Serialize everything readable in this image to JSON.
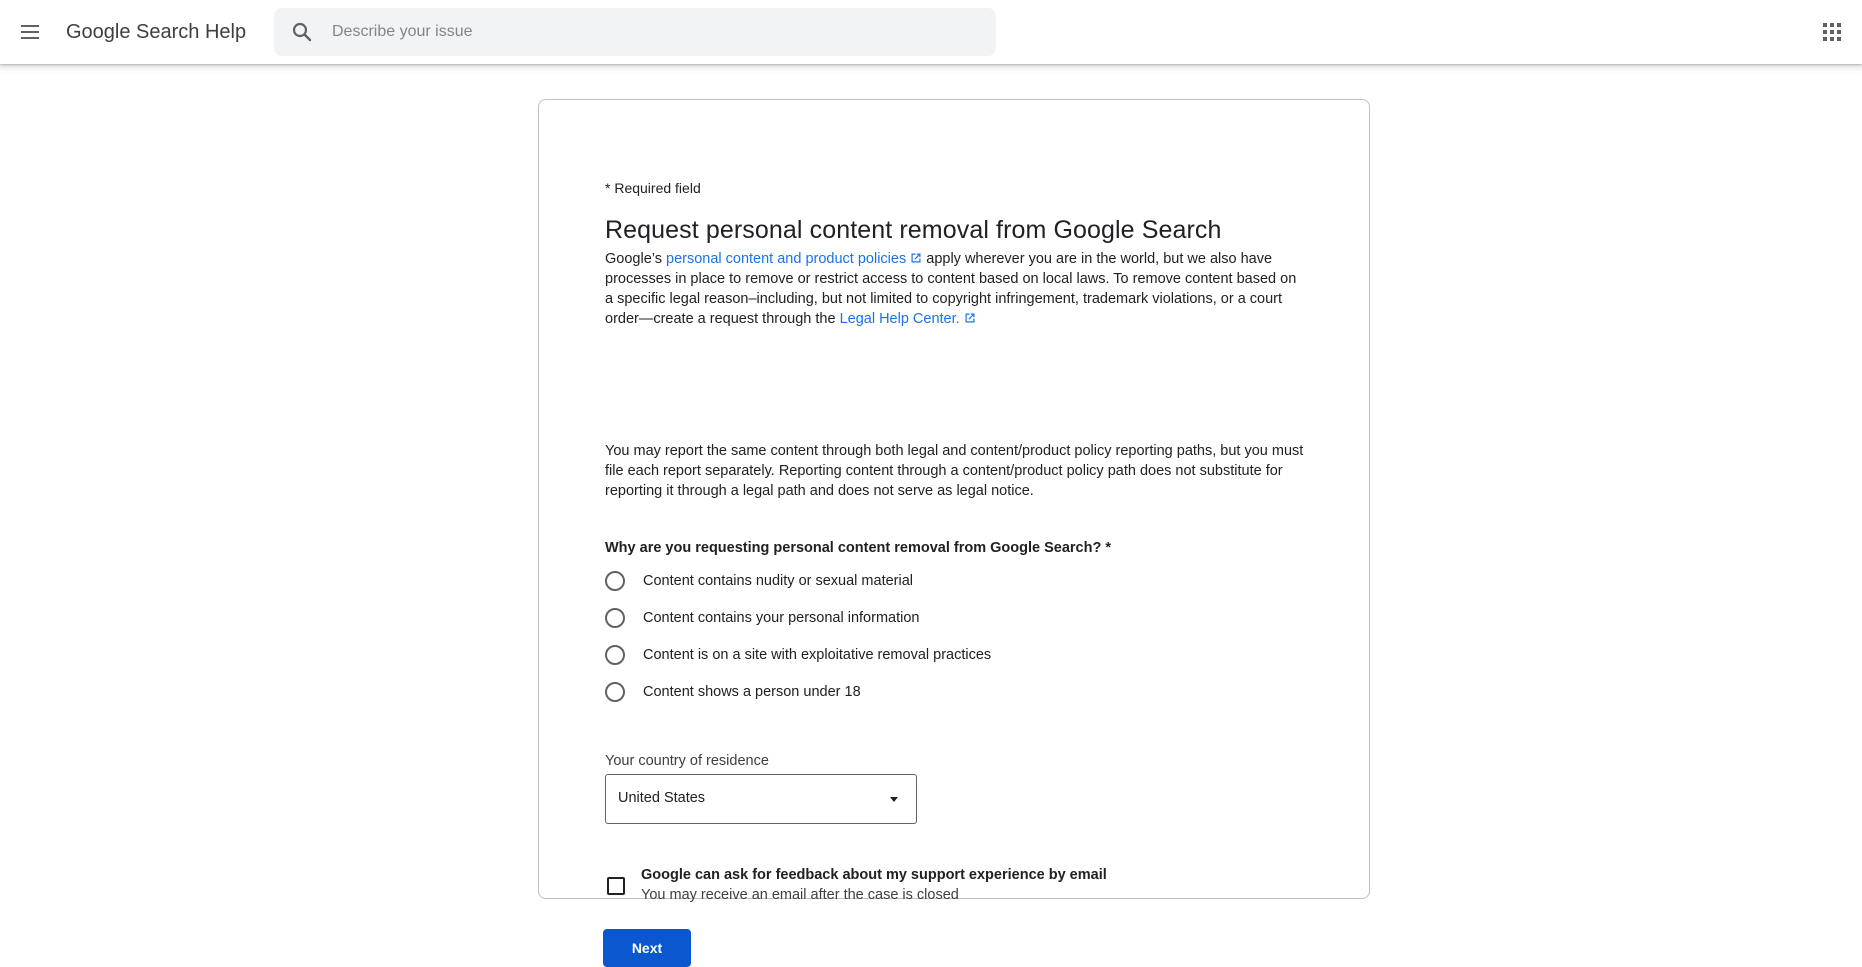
{
  "header": {
    "menu_icon": "hamburger-menu-icon",
    "title": "Google Search Help",
    "search": {
      "placeholder": "Describe your issue",
      "value": "",
      "icon": "search-icon"
    },
    "apps_icon": "apps-grid-icon"
  },
  "form": {
    "required_note": "* Required field",
    "title": "Request personal content removal from Google Search",
    "intro": {
      "prefix": "Google’s",
      "policy_link": "personal content and product policies",
      "middle": "apply wherever you are in the world, but we also have processes in place to remove or restrict access to content based on local laws. To remove content based on a specific legal reason–including, but not limited to copyright infringement, trademark violations, or a court order—create a request through the",
      "legal_link": "Legal Help Center."
    },
    "intro2": "You may report the same content through both legal and content/product policy reporting paths, but you must file each report separately. Reporting content through a content/product policy path does not substitute for reporting it through a legal path and does not serve as legal notice.",
    "question": "Why are you requesting personal content removal from Google Search? *",
    "options": [
      {
        "label": "Content contains nudity or sexual material",
        "selected": false
      },
      {
        "label": "Content contains your personal information",
        "selected": false
      },
      {
        "label": "Content is on a site with exploitative removal practices",
        "selected": false
      },
      {
        "label": "Content shows a person under 18",
        "selected": false
      }
    ],
    "country": {
      "label": "Your country of residence",
      "value": "United States"
    },
    "feedback": {
      "title": "Google can ask for feedback about my support experience by email",
      "subtitle": "You may receive an email after the case is closed",
      "checked": false
    },
    "next_label": "Next"
  },
  "colors": {
    "link": "#1a73e8",
    "primary_button": "#0b57d0"
  }
}
